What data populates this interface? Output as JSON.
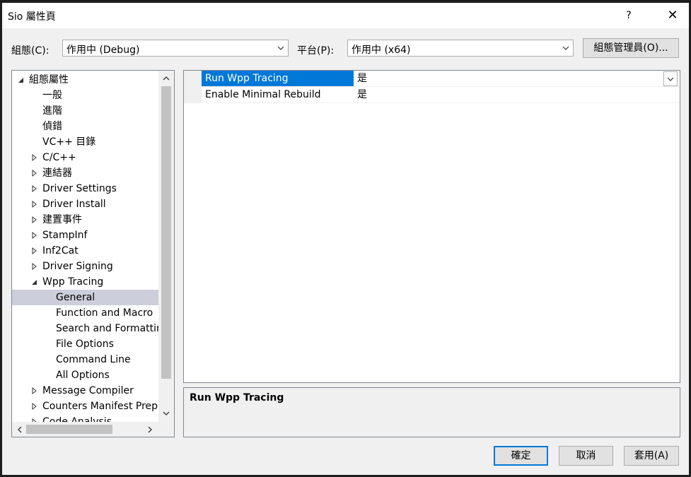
{
  "window": {
    "title": "Sio 屬性頁",
    "help_label": "?",
    "close_label": "✕"
  },
  "toolbar": {
    "config_label": "組態(C):",
    "config_value": "作用中 (Debug)",
    "platform_label": "平台(P):",
    "platform_value": "作用中 (x64)",
    "config_manager_label": "組態管理員(O)..."
  },
  "tree": {
    "items": [
      {
        "label": "組態屬性",
        "expander": "expanded"
      },
      {
        "label": "一般",
        "expander": "none"
      },
      {
        "label": "進階",
        "expander": "none"
      },
      {
        "label": "偵錯",
        "expander": "none"
      },
      {
        "label": "VC++ 目錄",
        "expander": "none"
      },
      {
        "label": "C/C++",
        "expander": "collapsed"
      },
      {
        "label": "連結器",
        "expander": "collapsed"
      },
      {
        "label": "Driver Settings",
        "expander": "collapsed"
      },
      {
        "label": "Driver Install",
        "expander": "collapsed"
      },
      {
        "label": "建置事件",
        "expander": "collapsed"
      },
      {
        "label": "StampInf",
        "expander": "collapsed"
      },
      {
        "label": "Inf2Cat",
        "expander": "collapsed"
      },
      {
        "label": "Driver Signing",
        "expander": "collapsed"
      },
      {
        "label": "Wpp Tracing",
        "expander": "expanded"
      },
      {
        "label": "General",
        "expander": "none"
      },
      {
        "label": "Function and Macro",
        "expander": "none"
      },
      {
        "label": "Search and Formatting",
        "expander": "none"
      },
      {
        "label": "File Options",
        "expander": "none"
      },
      {
        "label": "Command Line",
        "expander": "none"
      },
      {
        "label": "All Options",
        "expander": "none"
      },
      {
        "label": "Message Compiler",
        "expander": "collapsed"
      },
      {
        "label": "Counters Manifest Preprocessor",
        "expander": "collapsed"
      },
      {
        "label": "Code Analysis",
        "expander": "collapsed"
      }
    ],
    "selected_label": "General"
  },
  "grid": {
    "rows": [
      {
        "name": "Run Wpp Tracing",
        "value": "是"
      },
      {
        "name": "Enable Minimal Rebuild",
        "value": "是"
      }
    ]
  },
  "description": {
    "title": "Run Wpp Tracing"
  },
  "buttons": {
    "ok": "確定",
    "cancel": "取消",
    "apply": "套用(A)"
  },
  "colors": {
    "accent": "#0078d7",
    "tree_selection": "#cccedb",
    "dialog_bg": "#f0f0f0"
  }
}
